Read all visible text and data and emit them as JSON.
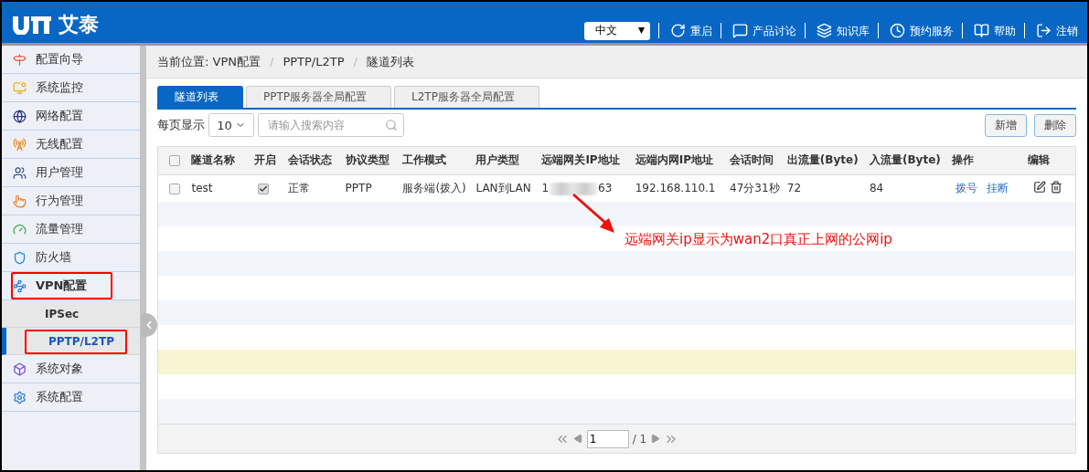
{
  "header": {
    "brand": "艾泰",
    "language": "中文",
    "menu": [
      {
        "label": "重启"
      },
      {
        "label": "产品讨论"
      },
      {
        "label": "知识库"
      },
      {
        "label": "预约服务"
      },
      {
        "label": "帮助"
      },
      {
        "label": "注销"
      }
    ]
  },
  "sidebar": {
    "items": [
      {
        "label": "配置向导",
        "annotated": false,
        "expanded": false
      },
      {
        "label": "系统监控",
        "annotated": false,
        "expanded": false
      },
      {
        "label": "网络配置",
        "annotated": false,
        "expanded": false
      },
      {
        "label": "无线配置",
        "annotated": false,
        "expanded": false
      },
      {
        "label": "用户管理",
        "annotated": false,
        "expanded": false
      },
      {
        "label": "行为管理",
        "annotated": false,
        "expanded": false
      },
      {
        "label": "流量管理",
        "annotated": false,
        "expanded": false
      },
      {
        "label": "防火墙",
        "annotated": false,
        "expanded": false
      },
      {
        "label": "VPN配置",
        "annotated": true,
        "expanded": true,
        "children": [
          {
            "label": "IPSec",
            "selected": false,
            "annotated": false
          },
          {
            "label": "PPTP/L2TP",
            "selected": true,
            "annotated": true
          }
        ]
      },
      {
        "label": "系统对象",
        "annotated": false,
        "expanded": false
      },
      {
        "label": "系统配置",
        "annotated": false,
        "expanded": false
      }
    ]
  },
  "breadcrumb": {
    "prefix": "当前位置:",
    "items": [
      "VPN配置",
      "PPTP/L2TP",
      "隧道列表"
    ],
    "separators": [
      "/",
      "/"
    ]
  },
  "tabs": [
    {
      "label": "隧道列表",
      "selected": true
    },
    {
      "label": "PPTP服务器全局配置",
      "selected": false
    },
    {
      "label": "L2TP服务器全局配置",
      "selected": false
    }
  ],
  "toolbar": {
    "page_size_label": "每页显示",
    "page_size": "10",
    "search": {
      "placeholder": "请输入搜索内容"
    },
    "buttons": [
      "新增",
      "删除"
    ]
  },
  "table": {
    "all_checked": false,
    "columns": [
      "隧道名称",
      "开启",
      "会话状态",
      "协议类型",
      "工作模式",
      "用户类型",
      "远端网关IP地址",
      "远端内网IP地址",
      "会话时间",
      "出流量(Byte)",
      "入流量(Byte)",
      "操作",
      "编辑"
    ],
    "rows": [
      {
        "checked": false,
        "name": "test",
        "enabled": true,
        "status": "正常",
        "protocol": "PPTP",
        "mode": "服务端(拨入)",
        "user_type": "LAN到LAN",
        "remote_gateway_ip": {
          "start": "1",
          "end": "63"
        },
        "remote_lan_ip": "192.168.110.1",
        "session_time": "47分31秒",
        "outbound": "72",
        "inbound": "84",
        "actions": [
          "拨号",
          "挂断"
        ]
      }
    ],
    "empty_rows": [
      {
        "highlighted": false
      },
      {
        "highlighted": false
      },
      {
        "highlighted": false
      },
      {
        "highlighted": false
      },
      {
        "highlighted": false
      },
      {
        "highlighted": false
      },
      {
        "highlighted": true
      },
      {
        "highlighted": false
      },
      {
        "highlighted": false
      }
    ]
  },
  "pagination": {
    "page": "1",
    "total": "/ 1"
  },
  "annotation": {
    "text": "远端网关ip显示为wan2口真正上网的公网ip"
  }
}
